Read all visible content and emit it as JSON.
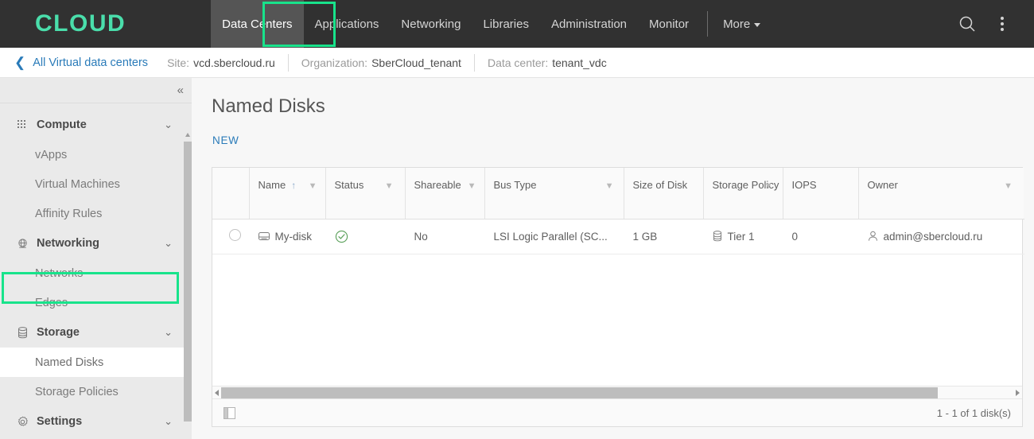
{
  "header": {
    "logo": "CLOUD",
    "nav": [
      {
        "label": "Data Centers",
        "active": true
      },
      {
        "label": "Applications",
        "active": false
      },
      {
        "label": "Networking",
        "active": false
      },
      {
        "label": "Libraries",
        "active": false
      },
      {
        "label": "Administration",
        "active": false
      },
      {
        "label": "Monitor",
        "active": false
      }
    ],
    "more_label": "More",
    "search_icon": "search-icon",
    "menu_icon": "kebab-menu-icon",
    "accent_color": "#4adeab",
    "bar_color": "#313131"
  },
  "breadcrumb": {
    "back_label": "All Virtual data centers",
    "items": [
      {
        "label": "Site:",
        "value": "vcd.sbercloud.ru"
      },
      {
        "label": "Organization:",
        "value": "SberCloud_tenant"
      },
      {
        "label": "Data center:",
        "value": "tenant_vdc"
      }
    ]
  },
  "sidebar": {
    "collapse_icon": "collapse-left-icon",
    "groups": [
      {
        "label": "Compute",
        "icon": "grid-dots-icon",
        "expanded": true,
        "items": [
          {
            "label": "vApps",
            "selected": false
          },
          {
            "label": "Virtual Machines",
            "selected": false
          },
          {
            "label": "Affinity Rules",
            "selected": false
          }
        ]
      },
      {
        "label": "Networking",
        "icon": "network-globe-icon",
        "expanded": true,
        "items": [
          {
            "label": "Networks",
            "selected": false
          },
          {
            "label": "Edges",
            "selected": false
          }
        ]
      },
      {
        "label": "Storage",
        "icon": "database-icon",
        "expanded": true,
        "items": [
          {
            "label": "Named Disks",
            "selected": true
          },
          {
            "label": "Storage Policies",
            "selected": false
          }
        ]
      },
      {
        "label": "Settings",
        "icon": "gear-icon",
        "expanded": true,
        "items": []
      }
    ]
  },
  "main": {
    "title": "Named Disks",
    "new_button": "NEW",
    "grid": {
      "columns": [
        {
          "label": "Name",
          "sortable": true,
          "sort": "asc",
          "filter": true
        },
        {
          "label": "Status",
          "filter": true
        },
        {
          "label": "Shareable",
          "filter": true
        },
        {
          "label": "Bus Type",
          "filter": true
        },
        {
          "label": "Size of Disk",
          "filter": false
        },
        {
          "label": "Storage Policy",
          "filter": true
        },
        {
          "label": "IOPS",
          "filter": false
        },
        {
          "label": "Owner",
          "filter": true
        }
      ],
      "rows": [
        {
          "name": "My-disk",
          "name_icon": "disk-icon",
          "status": "ok",
          "status_icon": "check-circle-icon",
          "shareable": "No",
          "bus_type": "LSI Logic Parallel (SC...",
          "size_of_disk": "1 GB",
          "storage_policy": "Tier 1",
          "storage_policy_icon": "database-icon",
          "iops": "0",
          "owner": "admin@sbercloud.ru",
          "owner_icon": "user-icon"
        }
      ],
      "footer_count": "1 - 1 of 1 disk(s)",
      "column_config_icon": "column-settings-icon"
    }
  },
  "annotations": {
    "highlight_color": "#18e38b",
    "boxes": [
      "data-centers-tab",
      "named-disks-sidebar-item"
    ]
  }
}
